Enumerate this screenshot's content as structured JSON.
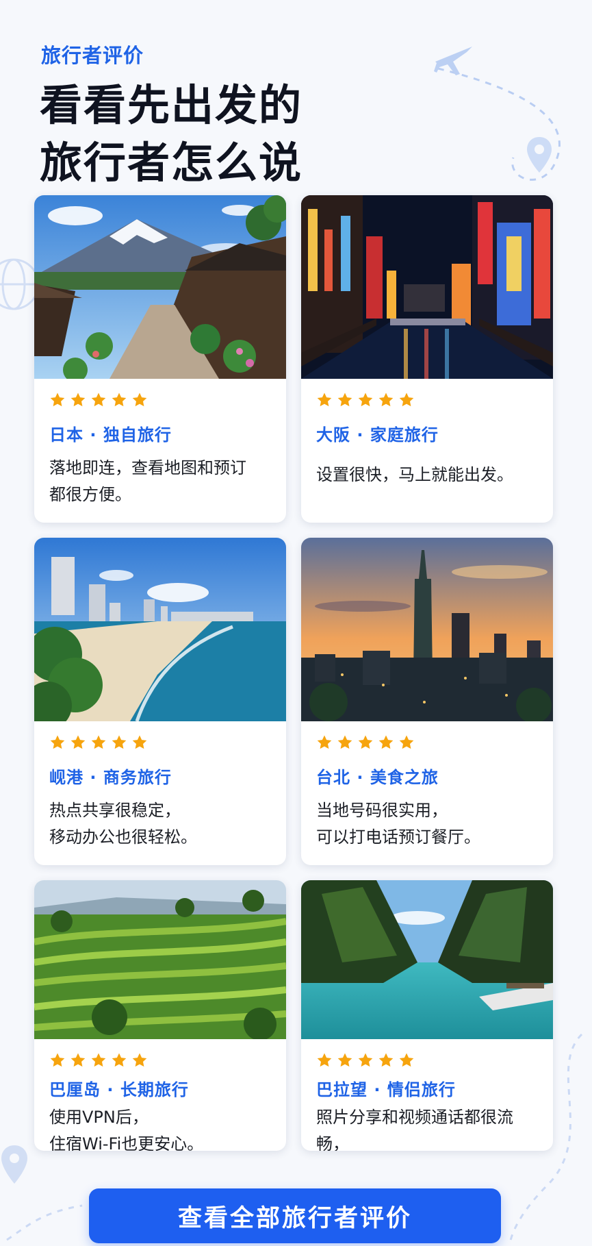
{
  "header": {
    "eyebrow": "旅行者评价",
    "headline": "看看先出发的\n旅行者怎么说"
  },
  "reviews": [
    {
      "place": "日本 · 独自旅行",
      "rating": 5,
      "quote": "落地即连，查看地图和预订\n都很方便。",
      "image": "fuji-village-photo"
    },
    {
      "place": "大阪 · 家庭旅行",
      "rating": 5,
      "quote": "设置很快，马上就能出发。",
      "image": "osaka-dotonbori-night-photo"
    },
    {
      "place": "岘港 · 商务旅行",
      "rating": 5,
      "quote": "热点共享很稳定，\n移动办公也很轻松。",
      "image": "danang-beach-photo"
    },
    {
      "place": "台北 · 美食之旅",
      "rating": 5,
      "quote": "当地号码很实用，\n可以打电话预订餐厅。",
      "image": "taipei-101-sunset-photo"
    },
    {
      "place": "巴厘岛 · 长期旅行",
      "rating": 5,
      "quote": "使用VPN后，\n住宿Wi-Fi也更安心。",
      "image": "bali-rice-terrace-photo"
    },
    {
      "place": "巴拉望 · 情侣旅行",
      "rating": 5,
      "quote": "照片分享和视频通话都很流畅，\n没有中断。",
      "image": "palawan-lagoon-photo"
    }
  ],
  "cta": {
    "label": "查看全部旅行者评价"
  },
  "colors": {
    "accent": "#1f63e6",
    "star": "#f6a40e",
    "button": "#1e5ff0",
    "background": "#f6f8fc"
  }
}
